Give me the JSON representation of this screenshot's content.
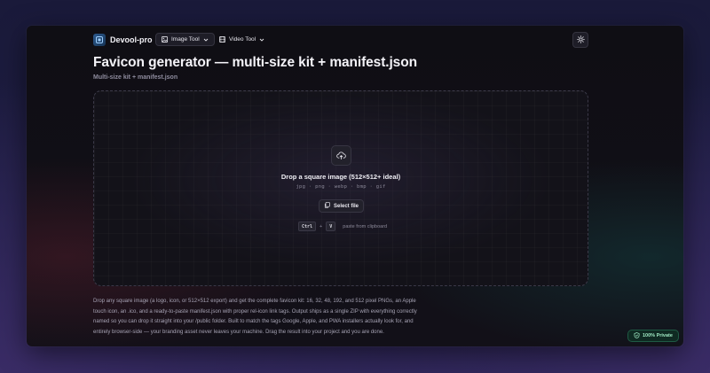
{
  "app": {
    "name": "Devool-pro"
  },
  "nav": {
    "image_tool": "Image Tool",
    "video_tool": "Video Tool"
  },
  "page": {
    "title": "Favicon generator — multi-size kit + manifest.json",
    "subtitle": "Multi-size kit + manifest.json"
  },
  "dropzone": {
    "title": "Drop a square image (512×512+ ideal)",
    "formats": "jpg · png · webp · bmp · gif",
    "select_label": "Select file",
    "kbd_ctrl": "Ctrl",
    "kbd_plus": "+",
    "kbd_v": "V",
    "paste_hint": "paste from clipboard"
  },
  "description": "Drop any square image (a logo, icon, or 512×512 export) and get the complete favicon kit: 16, 32, 48, 192, and 512 pixel PNGs, an Apple touch icon, an .ico, and a ready-to-paste manifest.json with proper rel-icon link tags. Output ships as a single ZIP with everything correctly named so you can drop it straight into your /public folder. Built to match the tags Google, Apple, and PWA installers actually look for, and entirely browser-side — your branding asset never leaves your machine. Drag the result into your project and you are done.",
  "badge": {
    "private": "100% Private"
  },
  "icons": {
    "logo": "brand-logo-icon",
    "image_tool": "image-icon",
    "video_tool": "film-icon",
    "theme": "sun-icon",
    "upload": "cloud-upload-icon",
    "file": "file-copy-icon",
    "shield": "shield-check-icon"
  },
  "colors": {
    "page_bg": "#1e1a3a",
    "window_bg": "#0f0e14",
    "accent_green": "#9ee8c2"
  }
}
